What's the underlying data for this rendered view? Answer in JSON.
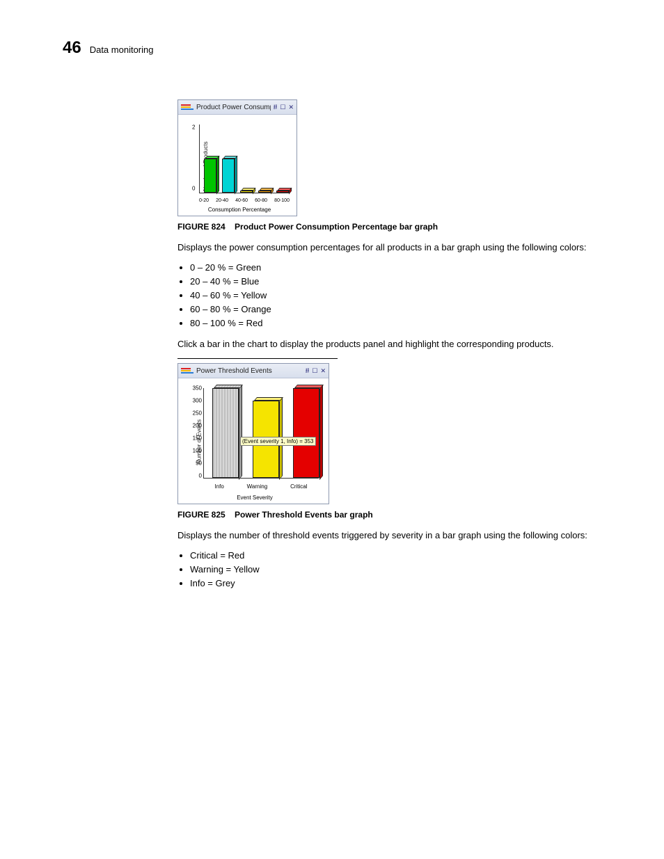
{
  "header": {
    "chapter": "46",
    "title": "Data monitoring"
  },
  "fig1": {
    "label": "FIGURE 824",
    "caption": "Product Power Consumption Percentage bar graph",
    "widget_title": "Product Power Consumption P..."
  },
  "para1": "Displays the power consumption percentages for all products in a bar graph using the following colors:",
  "color_legend_1": [
    "0 –  20 % = Green",
    "20 – 40 % = Blue",
    "40 – 60 % = Yellow",
    "60 – 80 % = Orange",
    "80 – 100 % = Red"
  ],
  "para2": "Click a bar in the chart to display the products panel and highlight the corresponding products.",
  "fig2": {
    "label": "FIGURE 825",
    "caption": "Power Threshold Events bar graph",
    "widget_title": "Power Threshold Events",
    "tooltip": "(Event severity 1, Info) = 353"
  },
  "para3": "Displays the number of threshold events triggered by severity in a bar graph using the following colors:",
  "color_legend_2": [
    "Critical = Red",
    "Warning = Yellow",
    "Info = Grey"
  ],
  "chart_data": [
    {
      "type": "bar",
      "title": "Product Power Consumption P...",
      "categories": [
        "0-20",
        "20-40",
        "40-60",
        "60-80",
        "80-100"
      ],
      "values": [
        1,
        1,
        0,
        0,
        0
      ],
      "colors": [
        "#00c400",
        "#00d4d4",
        "#f5e400",
        "#f59b00",
        "#e40000"
      ],
      "xlabel": "Consumption Percentage",
      "ylabel": "Number of Products",
      "ylim": [
        0,
        2
      ],
      "yticks": [
        0,
        2
      ]
    },
    {
      "type": "bar",
      "title": "Power Threshold Events",
      "categories": [
        "Info",
        "Warning",
        "Critical"
      ],
      "values": [
        353,
        300,
        350
      ],
      "colors": [
        "#bfbfbf",
        "#f5e400",
        "#e40000"
      ],
      "xlabel": "Event Severity",
      "ylabel": "Number of Events",
      "ylim": [
        0,
        350
      ],
      "yticks": [
        0,
        50,
        100,
        150,
        200,
        250,
        300,
        350
      ],
      "tooltip": "(Event severity 1, Info) = 353"
    }
  ]
}
